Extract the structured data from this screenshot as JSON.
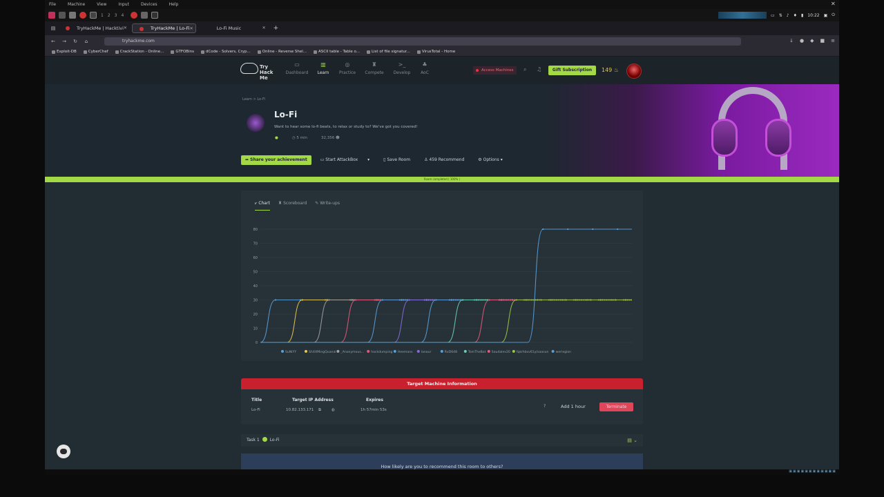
{
  "vm_menu": [
    "File",
    "Machine",
    "View",
    "Input",
    "Devices",
    "Help"
  ],
  "taskbar": {
    "workspaces": [
      "1",
      "2",
      "3",
      "4"
    ],
    "clock": "10:22"
  },
  "browser": {
    "tabs": [
      {
        "label": "TryHackMe | Hacktivi",
        "active": false
      },
      {
        "label": "TryHackMe | Lo-Fi",
        "active": true
      },
      {
        "label": "Lo-Fi Music",
        "active": false
      }
    ],
    "url": "tryhackme.com",
    "bookmarks": [
      "Exploit-DB",
      "CyberChef",
      "CrackStation - Online...",
      "GTFOBins",
      "dCode - Solvers, Cryp...",
      "Online - Reverse Shel...",
      "ASCII table - Table o...",
      "List of file signatur...",
      "VirusTotal - Home"
    ]
  },
  "header": {
    "logo_lines": [
      "Try",
      "Hack",
      "Me"
    ],
    "nav": [
      {
        "label": "Dashboard",
        "icon": "dashboard-icon"
      },
      {
        "label": "Learn",
        "icon": "book-icon",
        "active": true
      },
      {
        "label": "Practice",
        "icon": "target-icon"
      },
      {
        "label": "Compete",
        "icon": "trophy-icon"
      },
      {
        "label": "Develop",
        "icon": "terminal-icon"
      },
      {
        "label": "AoC",
        "icon": "tree-icon"
      }
    ],
    "access_machines": "Access Machines",
    "gift": "Gift Subscription",
    "streak": "149"
  },
  "room": {
    "breadcrumb": "Learn > Lo-Fi",
    "title": "Lo-Fi",
    "description": "Want to hear some lo-fi beats, to relax or study to? We've got you covered!",
    "duration": "5 min",
    "users": "32,356",
    "share": "Share your achievement",
    "attackbox": "Start AttackBox",
    "save": "Save Room",
    "recommend": "459 Recommend",
    "options": "Options",
    "progress_text": "Room completed ( 100% )",
    "progress": 1.0
  },
  "card": {
    "tabs": [
      "Chart",
      "Scoreboard",
      "Write-ups"
    ]
  },
  "chart_data": {
    "type": "line",
    "ylim": [
      0,
      80
    ],
    "yticks": [
      0,
      10,
      20,
      30,
      40,
      50,
      60,
      70,
      80
    ],
    "series": [
      {
        "name": "SuNiYY",
        "color": "#5aa0d8"
      },
      {
        "name": "ShXXMingQuanai",
        "color": "#e8c84a"
      },
      {
        "name": "_Anonymous...",
        "color": "#a0a0a0"
      },
      {
        "name": "hackdumping",
        "color": "#e25a7a"
      },
      {
        "name": "Heemans",
        "color": "#5aa0d8"
      },
      {
        "name": "lanaur",
        "color": "#8a6ad8"
      },
      {
        "name": "RxD648",
        "color": "#5aa0d8"
      },
      {
        "name": "TomTheBot",
        "color": "#6ad0b0"
      },
      {
        "name": "Saudalev20",
        "color": "#e25a7a"
      },
      {
        "name": "fqkrhbsv61y/xaasun",
        "color": "#9ac84a"
      },
      {
        "name": "weriegion",
        "color": "#5aa0d8"
      }
    ],
    "plateau": [
      30,
      30,
      30,
      30,
      30,
      30,
      30,
      30,
      30,
      30,
      80
    ]
  },
  "target": {
    "header": "Target Machine Information",
    "title_label": "Title",
    "title_value": "Lo-Fi",
    "ip_label": "Target IP Address",
    "ip_value": "10.82.133.171",
    "expires_label": "Expires",
    "expires_value": "1h 57min 53s",
    "help": "?",
    "add_hour": "Add 1 hour",
    "terminate": "Terminate"
  },
  "task": {
    "label": "Task 1",
    "name": "Lo-Fi"
  },
  "recommend_prompt": "How likely are you to recommend this room to others?"
}
